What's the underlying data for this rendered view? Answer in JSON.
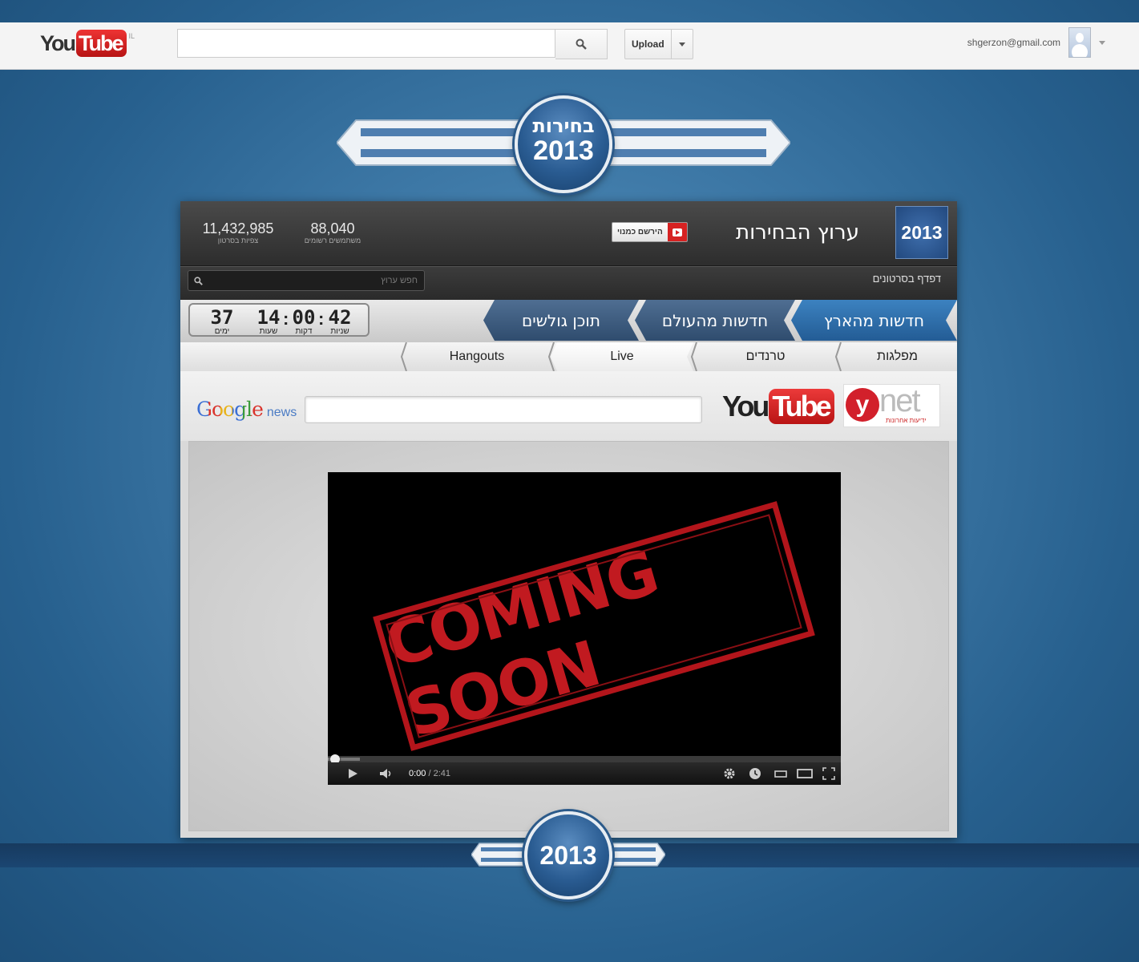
{
  "topbar": {
    "logo_you": "You",
    "logo_tube": "Tube",
    "logo_region": "IL",
    "search_placeholder": "",
    "upload_label": "Upload",
    "account_email": "shgerzon@gmail.com"
  },
  "banner": {
    "line1": "בחירות",
    "year": "2013"
  },
  "channel": {
    "views": "11,432,985",
    "views_caption": "צפיות בסרטון",
    "subscribers": "88,040",
    "subscribers_caption": "משתמשים רשומים",
    "subscribe_label": "הירשם כמנוי",
    "title": "ערוץ הבחירות",
    "thumb_label": "2013",
    "browse_placeholder": "חפש ערוץ",
    "browse_label": "דפדף בסרטונים"
  },
  "countdown": {
    "days": "37",
    "days_label": "ימים",
    "hours": "14",
    "hours_label": "שעות",
    "minutes": "00",
    "minutes_label": "דקות",
    "seconds": "42",
    "seconds_label": "שניות"
  },
  "nav_tabs": [
    {
      "label": "חדשות מהארץ",
      "active": true
    },
    {
      "label": "חדשות מהעולם",
      "active": false
    },
    {
      "label": "תוכן גולשים",
      "active": false
    }
  ],
  "sub_tabs": [
    {
      "label": "מפלגות"
    },
    {
      "label": "טרנדים"
    },
    {
      "label": "Live"
    },
    {
      "label": "Hangouts"
    }
  ],
  "partners": {
    "google": "Google",
    "google_news": "news",
    "youtube_you": "You",
    "youtube_tube": "Tube",
    "ynet_y": "y",
    "ynet_net": "net",
    "ynet_tag": "ידיעות אחרונות"
  },
  "player": {
    "stamp_text": "COMING SOON",
    "current_time": "0:00",
    "duration": "/ 2:41"
  },
  "footer_emblem": {
    "year": "2013"
  },
  "colors": {
    "active_tab": "#2b6aa6",
    "inactive_tab": "#3b5a7e",
    "stamp_red": "#c11a20"
  }
}
